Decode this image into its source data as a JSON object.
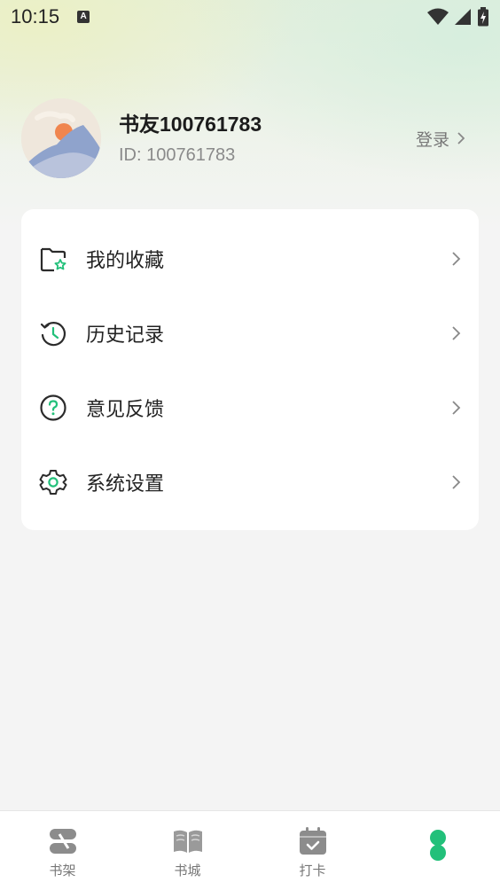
{
  "status_bar": {
    "time": "10:15",
    "notification_icon": "a-icon",
    "icons": [
      "wifi-icon",
      "signal-icon",
      "battery-icon"
    ]
  },
  "profile": {
    "name": "书友100761783",
    "id_text": "ID: 100761783",
    "login_label": "登录"
  },
  "menu": {
    "items": [
      {
        "label": "我的收藏",
        "icon": "favorites-folder-icon"
      },
      {
        "label": "历史记录",
        "icon": "history-clock-icon"
      },
      {
        "label": "意见反馈",
        "icon": "help-question-icon"
      },
      {
        "label": "系统设置",
        "icon": "settings-gear-icon"
      }
    ]
  },
  "bottom_nav": {
    "items": [
      {
        "label": "书架",
        "icon": "bookshelf-icon"
      },
      {
        "label": "书城",
        "icon": "bookstore-icon"
      },
      {
        "label": "打卡",
        "icon": "checkin-calendar-icon"
      },
      {
        "label": "",
        "icon": "profile-dots-icon",
        "active": true
      }
    ]
  },
  "colors": {
    "accent": "#22c07a",
    "icon_dark": "#333333",
    "card_bg": "#ffffff",
    "page_bg": "#f4f4f4"
  }
}
